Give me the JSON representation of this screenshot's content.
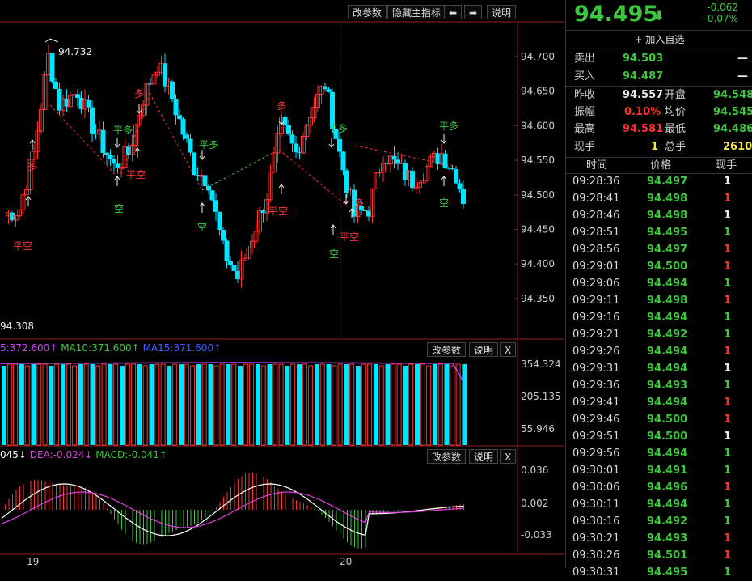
{
  "toolbar": {
    "main": [
      "改参数",
      "隐藏主指标",
      "⬅",
      "➡",
      "说明"
    ],
    "vol": [
      "改参数",
      "说明",
      "X"
    ],
    "macd": [
      "改参数",
      "说明",
      "X"
    ]
  },
  "main_chart": {
    "y_ticks": [
      "94.700",
      "94.650",
      "94.600",
      "94.550",
      "94.500",
      "94.450",
      "94.400",
      "94.350"
    ],
    "high_label": "94.732",
    "low_label": "94.308",
    "x_labels": [
      "19",
      "20"
    ]
  },
  "volume_panel": {
    "legend_ma5": "5:372.600↑",
    "legend_ma10": "MA10:371.600↑",
    "legend_ma15": "MA15:371.600↑",
    "y_ticks": [
      "354.324",
      "205.135",
      "55.946"
    ]
  },
  "macd_panel": {
    "legend_dif": "045↓",
    "legend_dea": "DEA:-0.024↓",
    "legend_macd": "MACD:-0.041↑",
    "y_ticks": [
      "0.036",
      "0.002",
      "-0.033"
    ]
  },
  "signals": {
    "long": "多",
    "short": "空",
    "close_short": "平空",
    "close_long": "平多"
  },
  "quote": {
    "last": "94.495",
    "arrow": "⬇",
    "change": "-0.062",
    "change_pct": "-0.07%",
    "add_watch": "+ 加入自选",
    "ask_label": "卖出",
    "ask": "94.503",
    "ask_vol": "—",
    "bid_label": "买入",
    "bid": "94.487",
    "bid_vol": "—",
    "prev_close_label": "昨收",
    "prev_close": "94.557",
    "open_label": "开盘",
    "open": "94.548",
    "amplitude_label": "振幅",
    "amplitude": "0.10%",
    "avg_label": "均价",
    "avg": "94.545",
    "high_label": "最高",
    "high": "94.581",
    "low_label": "最低",
    "low": "94.486",
    "cur_vol_label": "现手",
    "cur_vol": "1",
    "total_vol_label": "总手",
    "total_vol": "2610"
  },
  "ticks": {
    "headers": [
      "时间",
      "价格",
      "现手"
    ],
    "rows": [
      {
        "time": "09:28:36",
        "price": "94.497",
        "vol": "1",
        "dir": "w"
      },
      {
        "time": "09:28:41",
        "price": "94.498",
        "vol": "1",
        "dir": "r"
      },
      {
        "time": "09:28:46",
        "price": "94.498",
        "vol": "1",
        "dir": "w"
      },
      {
        "time": "09:28:51",
        "price": "94.495",
        "vol": "1",
        "dir": "g"
      },
      {
        "time": "09:28:56",
        "price": "94.497",
        "vol": "1",
        "dir": "r"
      },
      {
        "time": "09:29:01",
        "price": "94.500",
        "vol": "1",
        "dir": "r"
      },
      {
        "time": "09:29:06",
        "price": "94.494",
        "vol": "1",
        "dir": "g"
      },
      {
        "time": "09:29:11",
        "price": "94.498",
        "vol": "1",
        "dir": "r"
      },
      {
        "time": "09:29:16",
        "price": "94.494",
        "vol": "1",
        "dir": "g"
      },
      {
        "time": "09:29:21",
        "price": "94.492",
        "vol": "1",
        "dir": "g"
      },
      {
        "time": "09:29:26",
        "price": "94.494",
        "vol": "1",
        "dir": "r"
      },
      {
        "time": "09:29:31",
        "price": "94.494",
        "vol": "1",
        "dir": "w"
      },
      {
        "time": "09:29:36",
        "price": "94.493",
        "vol": "1",
        "dir": "g"
      },
      {
        "time": "09:29:41",
        "price": "94.494",
        "vol": "1",
        "dir": "r"
      },
      {
        "time": "09:29:46",
        "price": "94.500",
        "vol": "1",
        "dir": "r"
      },
      {
        "time": "09:29:51",
        "price": "94.500",
        "vol": "1",
        "dir": "w"
      },
      {
        "time": "09:29:56",
        "price": "94.494",
        "vol": "1",
        "dir": "g"
      },
      {
        "time": "09:30:01",
        "price": "94.491",
        "vol": "1",
        "dir": "g"
      },
      {
        "time": "09:30:06",
        "price": "94.496",
        "vol": "1",
        "dir": "r"
      },
      {
        "time": "09:30:11",
        "price": "94.494",
        "vol": "1",
        "dir": "g"
      },
      {
        "time": "09:30:16",
        "price": "94.492",
        "vol": "1",
        "dir": "g"
      },
      {
        "time": "09:30:21",
        "price": "94.493",
        "vol": "1",
        "dir": "r"
      },
      {
        "time": "09:30:26",
        "price": "94.501",
        "vol": "1",
        "dir": "r"
      },
      {
        "time": "09:30:31",
        "price": "94.495",
        "vol": "1",
        "dir": "g"
      }
    ]
  },
  "colors": {
    "up": "#ff3232",
    "down": "#00e5ff",
    "green": "#3ec63e",
    "ma": "#c040ff",
    "dif": "#ffffff",
    "dea": "#e040e0"
  }
}
